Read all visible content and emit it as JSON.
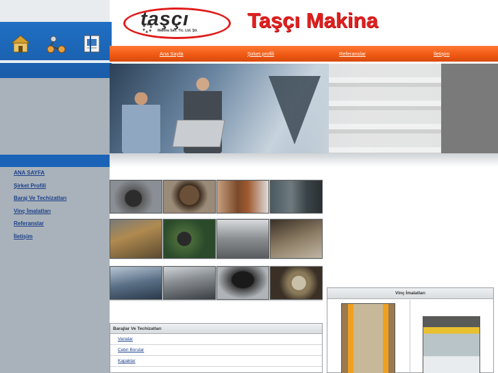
{
  "brand": {
    "logo_word": "taşçı",
    "logo_sub": "Makina San. Tic. Ltd. Şti.",
    "site_title": "Taşçı Makina"
  },
  "quick_icons": [
    "home-icon",
    "network-icon",
    "contact-icon"
  ],
  "nav": {
    "items": [
      "Ana Sayfa",
      "Şirket profili",
      "Referanslar",
      "İletişim"
    ]
  },
  "left_menu": {
    "items": [
      "ANA SAYFA",
      "Şirket Profili",
      "Baraj Ve Techizatları",
      "Vinç İmalatları",
      "Referanslar",
      "İletişim"
    ]
  },
  "baraj_panel": {
    "title": "Barajlar Ve Techizatları",
    "items": [
      "Vanalar",
      "Cebri Borular",
      "Kapaklar"
    ]
  },
  "vinc_panel": {
    "title": "Vinç İmalatları"
  },
  "colors": {
    "nav_orange": "#f05a14",
    "brand_red": "#e02020",
    "band_blue": "#1a63b6",
    "link_blue": "#1b3f8a"
  }
}
